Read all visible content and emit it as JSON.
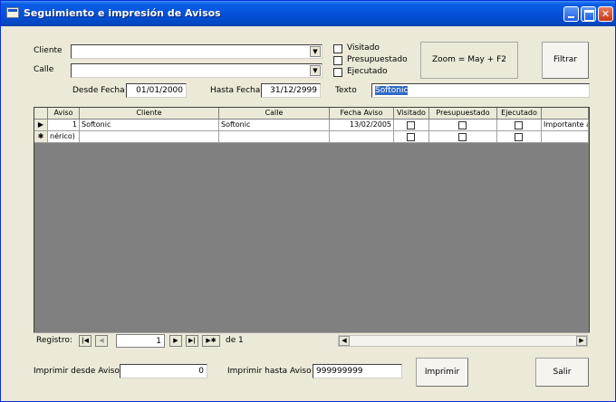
{
  "window": {
    "title": "Seguimiento e impresión de Avisos"
  },
  "filters": {
    "cliente_label": "Cliente",
    "cliente_value": "",
    "calle_label": "Calle",
    "calle_value": "",
    "visitado_label": "Visitado",
    "presupuestado_label": "Presupuestado",
    "ejecutado_label": "Ejecutado",
    "zoom_hint": "Zoom = May + F2",
    "filtrar_label": "Filtrar",
    "desde_fecha_label": "Desde Fecha",
    "desde_fecha_value": "01/01/2000",
    "hasta_fecha_label": "Hasta Fecha",
    "hasta_fecha_value": "31/12/2999",
    "texto_label": "Texto",
    "texto_value": "Softonic"
  },
  "grid": {
    "columns": [
      "Aviso",
      "Cliente",
      "Calle",
      "Fecha Aviso",
      "Visitado",
      "Presupuestado",
      "Ejecutado",
      ""
    ],
    "rows": [
      {
        "selector": "▶",
        "aviso": "1",
        "cliente": "Softonic",
        "calle": "Softonic",
        "fecha": "13/02/2005",
        "visitado": false,
        "presupuestado": false,
        "ejecutado": false,
        "extra": "Importante a"
      },
      {
        "selector": "✱",
        "aviso": "nérico)",
        "cliente": "",
        "calle": "",
        "fecha": "",
        "visitado": false,
        "presupuestado": false,
        "ejecutado": false,
        "extra": ""
      }
    ]
  },
  "navigator": {
    "label": "Registro:",
    "current": "1",
    "of_label": "de",
    "total": "1"
  },
  "footer": {
    "desde_aviso_label": "Imprimir desde Aviso",
    "desde_aviso_value": "0",
    "hasta_aviso_label": "Imprimir hasta Aviso",
    "hasta_aviso_value": "999999999",
    "imprimir_label": "Imprimir",
    "salir_label": "Salir"
  }
}
